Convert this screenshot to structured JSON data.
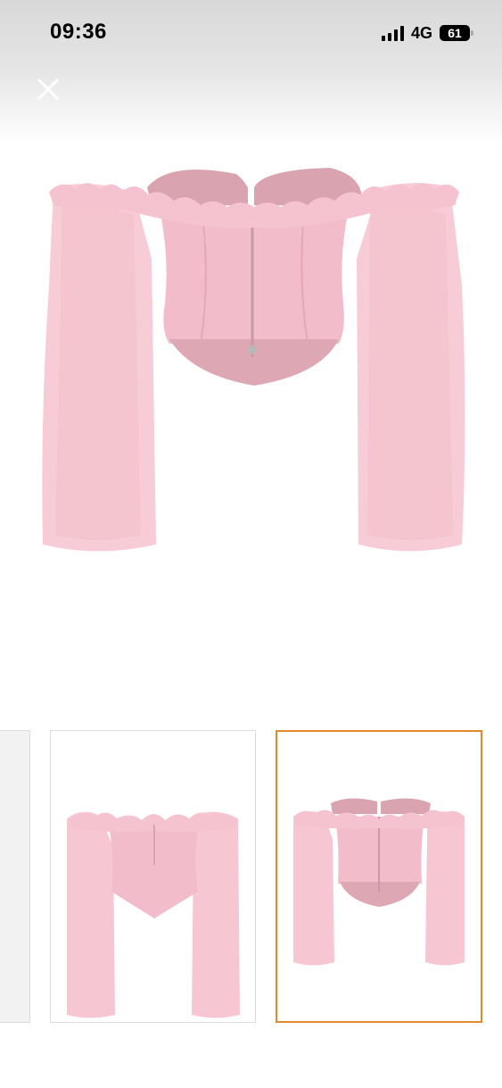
{
  "status_bar": {
    "time": "09:36",
    "network": "4G",
    "battery": "61"
  },
  "icons": {
    "close": "close-icon",
    "signal": "signal-icon",
    "battery": "battery-icon"
  },
  "colors": {
    "garment_pink": "#f4c1cd",
    "garment_dark": "#dba1ae",
    "selected_border": "#e08a2c"
  },
  "gallery": {
    "selected_index": 2
  }
}
